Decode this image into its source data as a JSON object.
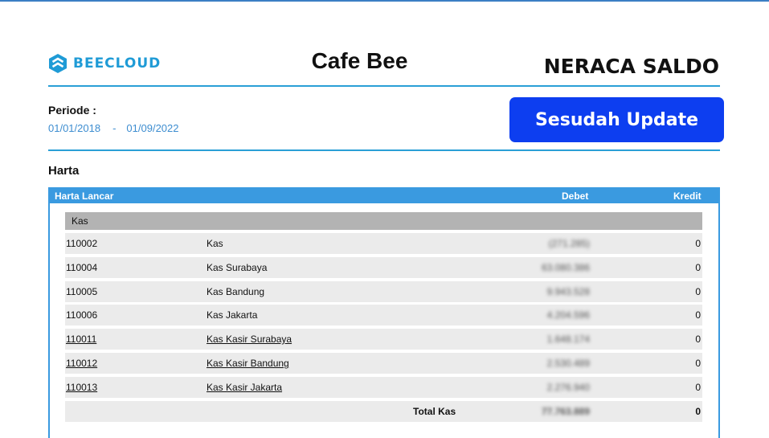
{
  "brand": {
    "name": "BEECLOUD",
    "logo_icon": "hexagon-chevron-icon",
    "color": "#1f9bd6"
  },
  "header": {
    "company": "Cafe Bee",
    "report_title": "NERACA SALDO"
  },
  "period": {
    "label": "Periode :",
    "start": "01/01/2018",
    "separator": "-",
    "end": "01/09/2022"
  },
  "update_button": {
    "label": "Sesudah Update",
    "color": "#0d3ef0"
  },
  "section": {
    "title": "Harta"
  },
  "table": {
    "columns": {
      "name": "Harta Lancar",
      "debet": "Debet",
      "kredit": "Kredit"
    },
    "group": "Kas",
    "rows": [
      {
        "code": "110002",
        "name": "Kas",
        "debet": "(271.285)",
        "kredit": "0",
        "link": false
      },
      {
        "code": "110004",
        "name": "Kas Surabaya",
        "debet": "63.080.386",
        "kredit": "0",
        "link": false
      },
      {
        "code": "110005",
        "name": "Kas Bandung",
        "debet": "9.943.528",
        "kredit": "0",
        "link": false
      },
      {
        "code": "110006",
        "name": "Kas Jakarta",
        "debet": "4.204.596",
        "kredit": "0",
        "link": false
      },
      {
        "code": "110011",
        "name": "Kas Kasir Surabaya",
        "debet": "1.648.174",
        "kredit": "0",
        "link": true
      },
      {
        "code": "110012",
        "name": "Kas Kasir Bandung",
        "debet": "2.530.489",
        "kredit": "0",
        "link": true
      },
      {
        "code": "110013",
        "name": "Kas Kasir Jakarta",
        "debet": "2.276.940",
        "kredit": "0",
        "link": true
      }
    ],
    "total": {
      "label": "Total Kas",
      "debet": "77.763.889",
      "kredit": "0"
    }
  }
}
